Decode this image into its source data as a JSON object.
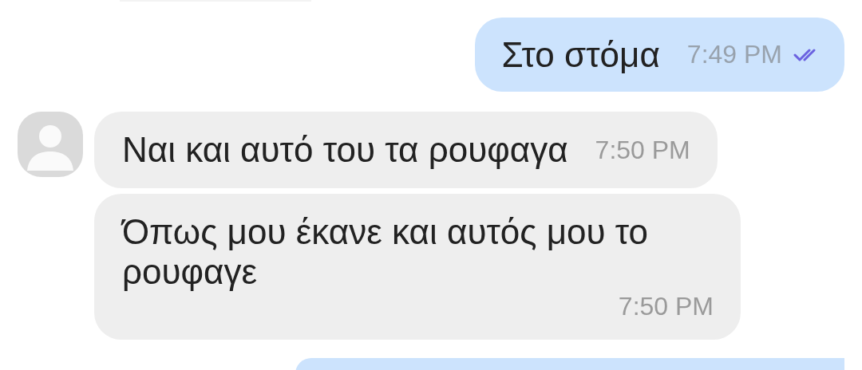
{
  "messages": [
    {
      "kind": "outgoing",
      "text": "Στο στόμα",
      "time": "7:49 PM",
      "read": true
    },
    {
      "kind": "incoming",
      "text": "Ναι και αυτό του τα ρουφαγα",
      "time": "7:50 PM",
      "show_avatar": true
    },
    {
      "kind": "incoming",
      "text": "Όπως μου έκανε και αυτός μου το ρουφαγε",
      "time": "7:50 PM",
      "show_avatar": false
    }
  ]
}
